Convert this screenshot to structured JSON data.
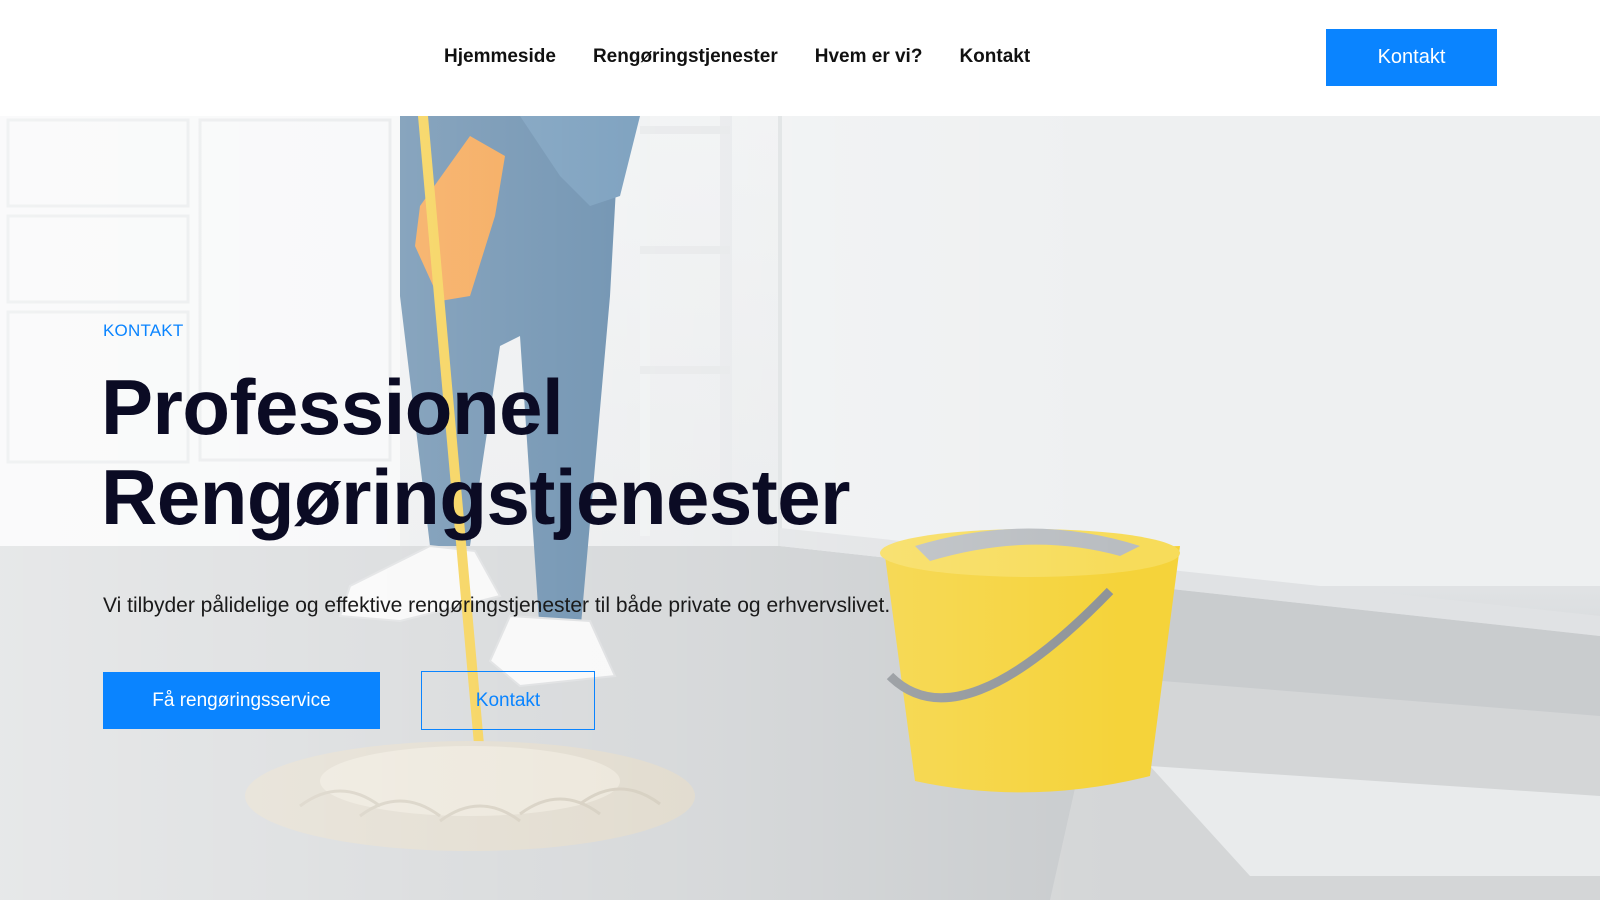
{
  "header": {
    "nav": [
      {
        "label": "Hjemmeside"
      },
      {
        "label": "Rengøringstjenester"
      },
      {
        "label": "Hvem er vi?"
      },
      {
        "label": "Kontakt"
      }
    ],
    "cta_label": "Kontakt"
  },
  "hero": {
    "eyebrow": "KONTAKT",
    "title_line1": "Professionel",
    "title_line2": "Rengøringstjenester",
    "subtitle": "Vi tilbyder pålidelige og effektive rengøringstjenester til både private og erhvervslivet.",
    "primary_button": "Få rengøringsservice",
    "secondary_button": "Kontakt"
  },
  "colors": {
    "accent": "#0a84ff",
    "title": "#0b0b24",
    "bucket": "#f5d33a",
    "glove": "#f28a1e",
    "mop_handle": "#f3c21a"
  },
  "icons": [
    "mop-illustration",
    "bucket-illustration"
  ]
}
